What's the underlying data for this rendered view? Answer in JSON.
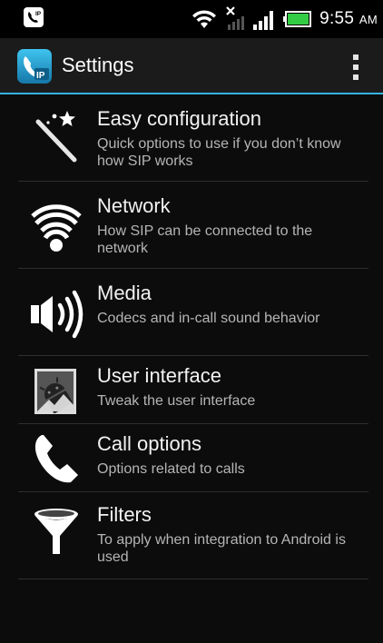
{
  "status_bar": {
    "time": "9:55",
    "time_suffix": "AM",
    "icons": [
      "csipsimple-notification-icon",
      "wifi-icon",
      "no-data-signal-icon",
      "cell-signal-icon",
      "battery-icon"
    ]
  },
  "action_bar": {
    "title": "Settings",
    "app_icon": "csipsimple-logo-icon",
    "accent_color": "#33b5e5",
    "menu_icon": "overflow-menu-icon"
  },
  "settings": [
    {
      "icon": "magic-wand-icon",
      "title": "Easy configuration",
      "summary": "Quick options to use if you don’t know how SIP works"
    },
    {
      "icon": "wifi-signal-icon",
      "title": "Network",
      "summary": "How SIP can be connected to the network"
    },
    {
      "icon": "speaker-volume-icon",
      "title": "Media",
      "summary": "Codecs and in-call sound behavior"
    },
    {
      "icon": "android-ui-icon",
      "title": "User interface",
      "summary": "Tweak the user interface"
    },
    {
      "icon": "phone-handset-icon",
      "title": "Call options",
      "summary": "Options related to calls"
    },
    {
      "icon": "filter-funnel-icon",
      "title": "Filters",
      "summary": "To apply when integration to Android is used"
    }
  ]
}
